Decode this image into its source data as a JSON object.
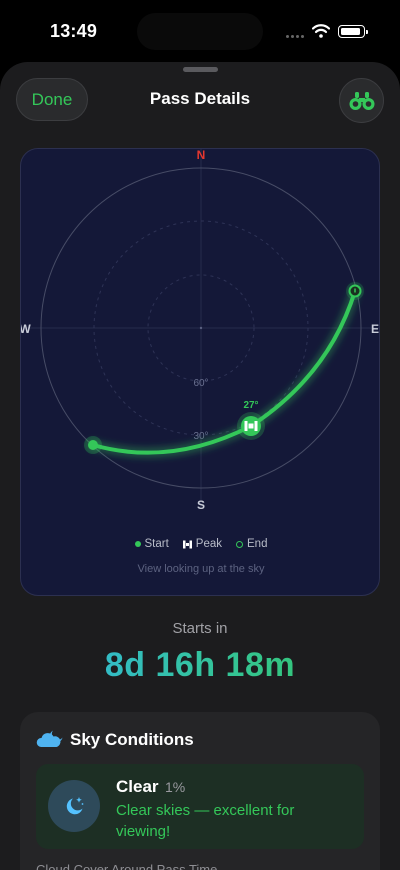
{
  "status_bar": {
    "time": "13:49"
  },
  "header": {
    "done_label": "Done",
    "title": "Pass Details",
    "binoculars_icon": "binoculars-icon"
  },
  "sky_map": {
    "directions": {
      "north": "N",
      "south": "S",
      "west": "W",
      "east": "E"
    },
    "elevation_rings": {
      "inner": "60°",
      "outer": "30°"
    },
    "peak_elevation": "27°",
    "legend": {
      "start": "Start",
      "peak": "Peak",
      "end": "End"
    },
    "caption": "View looking up at the sky",
    "colors": {
      "path": "#34c759",
      "background": "#141838"
    }
  },
  "countdown": {
    "label": "Starts in",
    "value": "8d 16h 18m"
  },
  "sky_conditions": {
    "title": "Sky Conditions",
    "cloud_icon": "cloud-moon-icon",
    "status": "Clear",
    "cloud_percent": "1%",
    "description": "Clear skies — excellent for viewing!",
    "status_icon": "moon-stars-icon",
    "cloud_cover_label": "Cloud Cover Around Pass Time"
  }
}
